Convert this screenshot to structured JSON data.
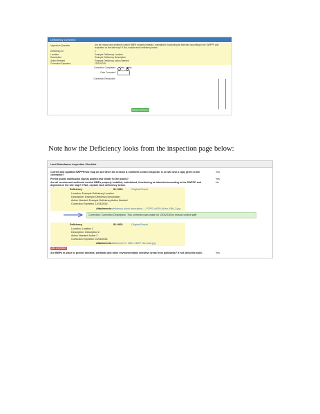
{
  "deficiency_dialog": {
    "title": "Deficiency Overview",
    "inspection_question": {
      "label": "Inspection Question",
      "value": "Are all erosion and sediment control BMPs properly installed, maintained, functioning as intended according to the SWPPP and replicated on the site map? If Not, explain each deficiency below."
    },
    "rows": [
      {
        "label": "Deficiency ID",
        "value": "1"
      },
      {
        "label": "Location",
        "value": "Example Deficiency Location"
      },
      {
        "label": "Description",
        "value": "Example Deficiency Description"
      },
      {
        "label": "Action Needed",
        "value": "Example Deficiency Action Needed"
      },
      {
        "label": "Correction Expected",
        "value": "12/24/2016"
      }
    ],
    "correction_completed_label": "Correction Completed",
    "radio_yes": "Yes",
    "radio_no": "No",
    "date_corrected_label": "Date Corrected",
    "correction_description_label": "Correction Description",
    "save_button": "Update Deficiency"
  },
  "caption": "Note how the Deficiency looks from the inspection page below:",
  "checklist": {
    "header": "Land Disturbance Inspection Checklist",
    "questions": [
      {
        "text": "Current and updated SWPPP/site map on site when the erosion & sediment control inspector is on site and a copy given to the",
        "text2": "contractor?",
        "answer": "Yes"
      },
      {
        "text": "Permit public notification sign(s) posted and visible to the public?",
        "answer": "Yes"
      },
      {
        "text": "Are all erosion and sediment control BMPs properly installed, maintained, functioning as intended according to the SWPPP and",
        "text2": "depicted on the site map? If Not, explain each deficiency below.",
        "answer": "No"
      }
    ],
    "deficiency1": {
      "title": "Deficiency",
      "id_label": "ID: 9601",
      "original_report": "Original Report",
      "location": "Location: Example Deficiency Location",
      "description": "Description: Example Deficiency Description",
      "action": "Action Needed: Example Deficiency Action Needed",
      "expected": "Correction Expected: 12/24/2016",
      "attachments_label": "Attachments:",
      "attachment_file": "deficiency photo description — PSPS-4c939-8c0ec-1f8b_3.jpg",
      "correction": "Correction: Correction Description. This correction was made on 1/03/2016 by erosion control staff."
    },
    "deficiency2": {
      "title": "Deficiency",
      "id_label": "ID: 9601",
      "original_report": "Original Report",
      "location": "Location: Location 2",
      "description": "Description: Description 2",
      "action": "Action Needed: Action 2",
      "expected": "Correction Expected: 01/04/2016",
      "attachments_label": "Attachments:",
      "attachment_1": "Attachment 2",
      "attachment_2": "4807-14007 Tax.bowl.jpg"
    },
    "add_correction": "Add Correction",
    "last_question": {
      "text": "Are BMPs in place to protect streams, wetlands and other environmentally sensitive areas from pollutants? If not, describe each.",
      "answer": "Yes"
    }
  },
  "colors": {
    "dialog_title_bar": "#3d7ab8",
    "highlight_yellow": "#fbf8c6",
    "correction_green": "#dff0d8",
    "save_button": "#5cb85c",
    "add_correction_button": "#d9534f",
    "link_blue": "#3a6fb0"
  }
}
